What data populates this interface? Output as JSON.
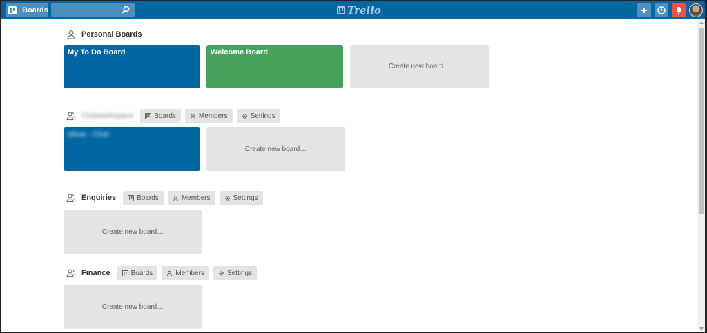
{
  "header": {
    "boards_label": "Boards",
    "search_value": "",
    "logo_text": "Trello",
    "add_label": "+",
    "info_label": "i",
    "notifications_label": "!"
  },
  "sections": [
    {
      "title": "Personal Boards",
      "icon": "person-icon",
      "boards": [
        "My To Do Board",
        "Welcome Board"
      ],
      "create_label": "Create new board…"
    },
    {
      "title": "Clubworkspace",
      "icon": "team-icon",
      "tabs": [
        "Boards",
        "Members",
        "Settings"
      ],
      "boards": [
        "Ideas - Club"
      ],
      "create_label": "Create new board…"
    },
    {
      "title": "Enquiries",
      "icon": "team-icon",
      "tabs": [
        "Boards",
        "Members",
        "Settings"
      ],
      "create_label": "Create new board…"
    },
    {
      "title": "Finance",
      "icon": "team-icon",
      "tabs": [
        "Boards",
        "Members",
        "Settings"
      ],
      "create_label": "Create new board…"
    }
  ],
  "colors": {
    "header": "#0067a3",
    "board_blue": "#0067a3",
    "board_green": "#45a25d",
    "create_tile": "#e2e4e6",
    "notification": "#e8544a"
  }
}
